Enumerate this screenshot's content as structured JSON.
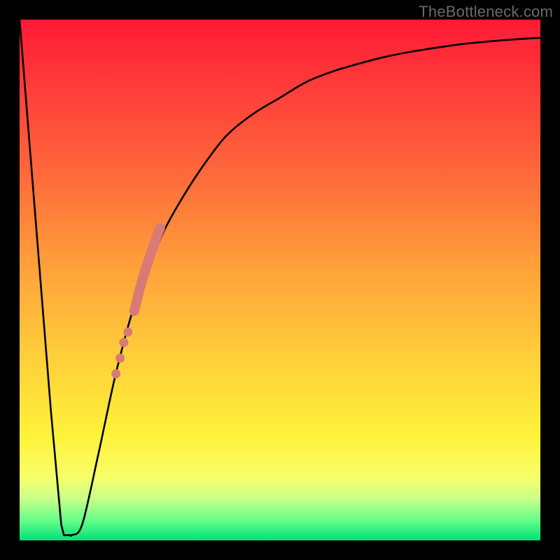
{
  "watermark": "TheBottleneck.com",
  "chart_data": {
    "type": "line",
    "title": "",
    "xlabel": "",
    "ylabel": "",
    "xlim": [
      0,
      100
    ],
    "ylim": [
      0,
      100
    ],
    "grid": false,
    "legend": false,
    "series": [
      {
        "name": "bottleneck-curve",
        "x": [
          0,
          6,
          8,
          9,
          10,
          12,
          15,
          18,
          20,
          22,
          25,
          28,
          32,
          36,
          40,
          45,
          50,
          55,
          60,
          65,
          70,
          75,
          80,
          85,
          90,
          95,
          100
        ],
        "values": [
          100,
          25,
          3,
          1,
          1,
          3,
          16,
          30,
          38,
          45,
          53,
          60,
          67,
          73,
          78,
          82,
          85,
          88,
          90,
          91.5,
          92.8,
          93.8,
          94.6,
          95.3,
          95.8,
          96.2,
          96.5
        ]
      }
    ],
    "flat_bottom": {
      "x_start": 8.5,
      "x_end": 10,
      "y": 1
    },
    "marker_band": {
      "name": "highlight-segment",
      "color": "#d97a76",
      "points": [
        {
          "x": 18.5,
          "y": 32,
          "r": 1.1
        },
        {
          "x": 19.3,
          "y": 35,
          "r": 1.1
        },
        {
          "x": 20.0,
          "y": 38,
          "r": 1.1
        },
        {
          "x": 20.8,
          "y": 40,
          "r": 1.1
        },
        {
          "x": 22.0,
          "y": 44,
          "r": 2.0
        },
        {
          "x": 23.0,
          "y": 48,
          "r": 2.0
        },
        {
          "x": 24.0,
          "y": 51.5,
          "r": 2.0
        },
        {
          "x": 25.0,
          "y": 54.5,
          "r": 2.0
        },
        {
          "x": 26.0,
          "y": 57.5,
          "r": 2.0
        },
        {
          "x": 27.0,
          "y": 60,
          "r": 2.0
        }
      ]
    },
    "background_gradient": {
      "top": "#ff1a36",
      "mid1": "#ffa23a",
      "mid2": "#fff23a",
      "bottom": "#00e078"
    }
  }
}
